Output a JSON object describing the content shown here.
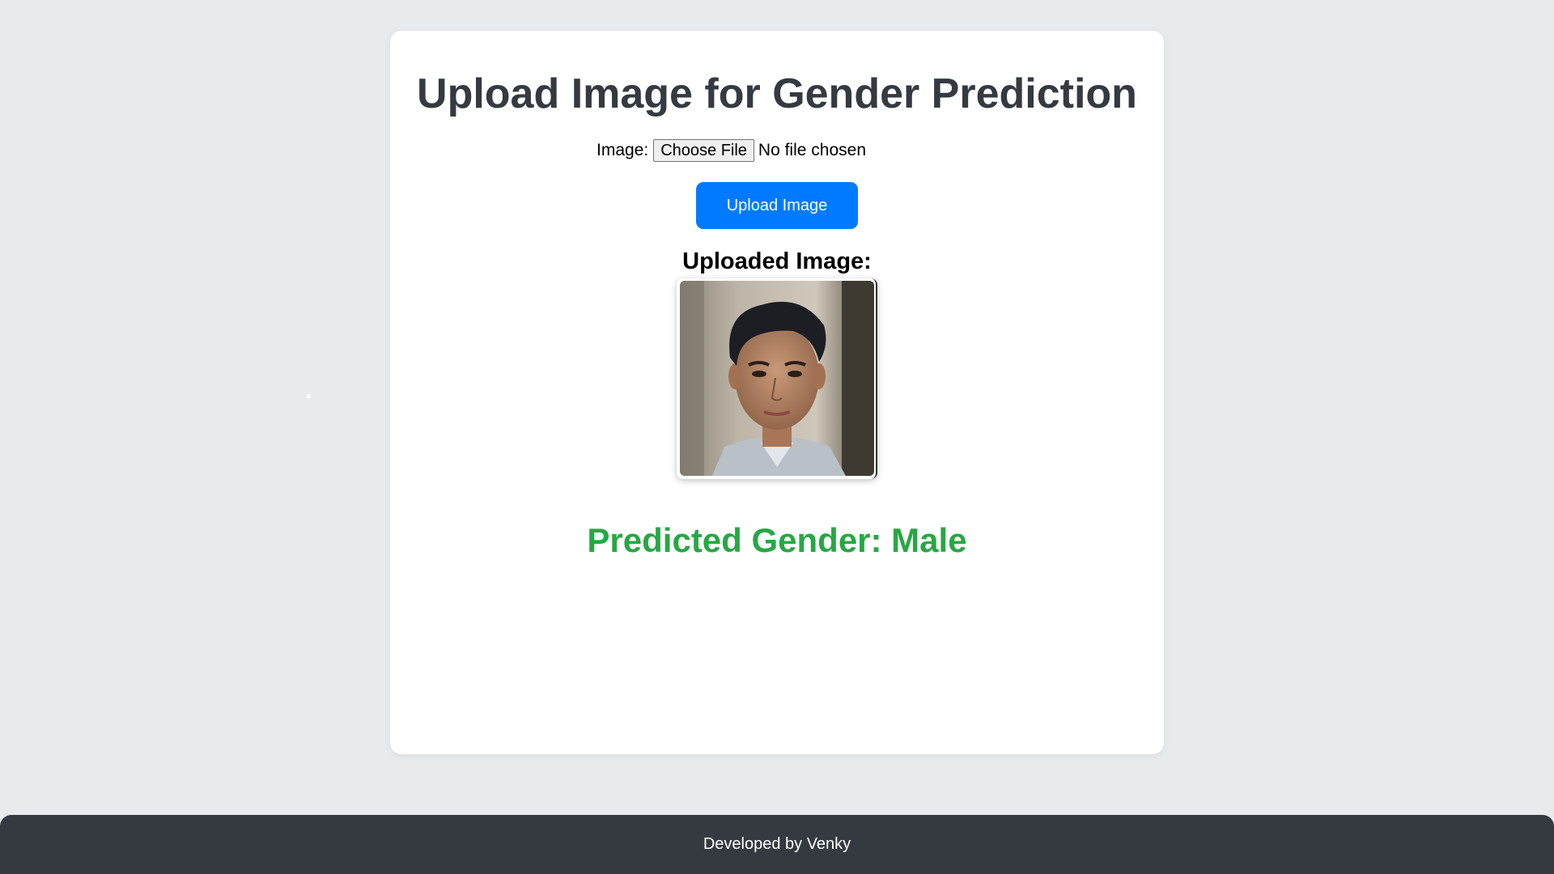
{
  "page": {
    "title": "Upload Image for Gender Prediction"
  },
  "form": {
    "image_label": "Image:",
    "choose_file_label": "Choose File",
    "file_status": "No file chosen",
    "upload_button_label": "Upload Image"
  },
  "preview": {
    "heading": "Uploaded Image:"
  },
  "result": {
    "text": "Predicted Gender: Male"
  },
  "footer": {
    "text": "Developed by Venky"
  },
  "colors": {
    "background": "#e8ebee",
    "card": "#ffffff",
    "title": "#343a40",
    "primary": "#007bff",
    "success": "#28a745",
    "footer": "#343a40"
  }
}
